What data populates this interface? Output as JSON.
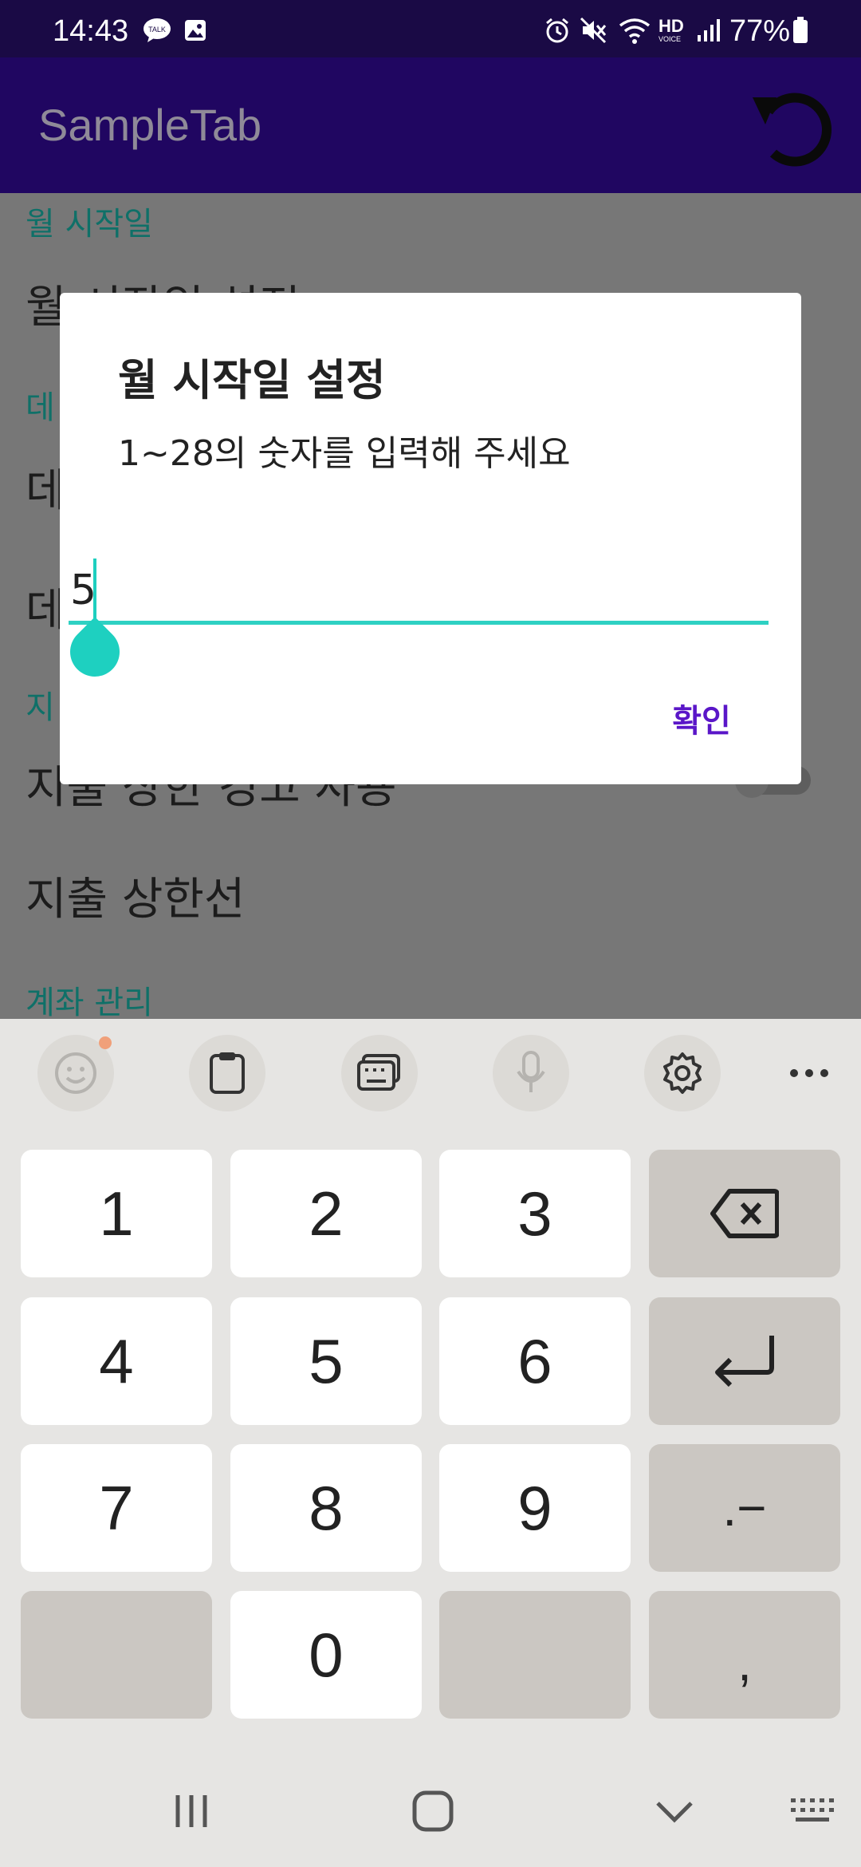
{
  "status_bar": {
    "time": "14:43",
    "battery": "77%",
    "icons": [
      "talk-icon",
      "gallery-icon",
      "alarm-icon",
      "mute-icon",
      "wifi-icon",
      "hd-voice-icon",
      "signal-icon",
      "battery-icon"
    ],
    "hd_label": "HD",
    "voice_label": "VOICE",
    "talk_label": "TALK"
  },
  "app_bar": {
    "title": "SampleTab",
    "action_icon": "undo-icon"
  },
  "settings": {
    "categories": [
      "월 시작일",
      "데",
      "지",
      "계좌 관리"
    ],
    "prefs": [
      "월 시작일 설정",
      "데",
      "데",
      "지출 상한 경고 사용",
      "지출 상한선"
    ]
  },
  "dialog": {
    "title": "월 시작일 설정",
    "message": "1~28의 숫자를 입력해 주세요",
    "input_value": "5",
    "confirm_label": "확인"
  },
  "keyboard": {
    "toolbar": [
      "emoji-icon",
      "clipboard-icon",
      "keyboard-icon",
      "mic-icon",
      "settings-icon",
      "more-icon"
    ],
    "rows": [
      [
        "1",
        "2",
        "3",
        "⌫"
      ],
      [
        "4",
        "5",
        "6",
        "↵"
      ],
      [
        "7",
        "8",
        "9",
        ".−"
      ],
      [
        "",
        "0",
        "",
        ","
      ]
    ]
  },
  "colors": {
    "status_bar": "#1a0a45",
    "app_bar": "#200661",
    "accent": "#2ed1c3",
    "dialog_button": "#5a16c8",
    "category_text": "#0f7068"
  },
  "nav_bar": [
    "recents-icon",
    "home-icon",
    "back-icon",
    "keyboard-switch-icon"
  ]
}
